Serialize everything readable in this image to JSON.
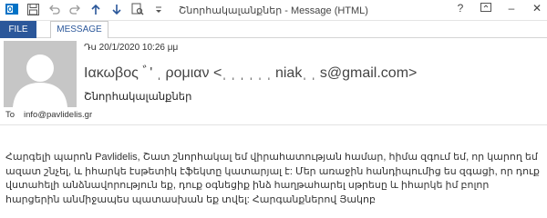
{
  "window": {
    "title": "Շնորհակալանքներ - Message (HTML)",
    "help": "?",
    "minimize": "–",
    "close": "✕"
  },
  "ribbon": {
    "file_tab": "FILE",
    "message_tab": "MESSAGE"
  },
  "message": {
    "date": "Դս 20/1/2020 10:26 μμ",
    "from": "Ιακωβος ﾞ' ˌ ρομιαν <ˌ ˌ ˌ ˌ ˌ ˌ niakˌ ˌ s@gmail.com>",
    "subject": "Շնորհակալանքներ",
    "to_label": "To",
    "to": "info@pavlidelis.gr",
    "body": "Հարգելի պարոն Pavlidelis, Շատ շնորհակալ եմ վիրահատության համար, հիմա զգում եմ, որ կարող եմ ազատ շնչել, և իհարկե էսթետիկ էֆեկտը կատարյալ է: Մեր առաջին հանդիպումից ես զգացի, որ դուք վստահելի անձնավորություն եք, դուք օգնեցիք ինձ հաղթահարել սթրեսը և իհարկե իմ բոլոր հարցերին անմիջապես պատասխան եք տվել: Հարգանքներով Յակոբ"
  }
}
